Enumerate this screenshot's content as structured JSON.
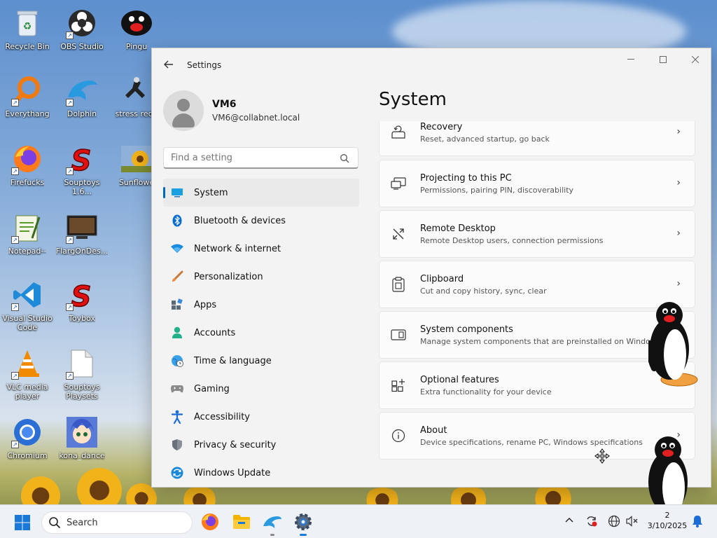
{
  "desktop": {
    "icons": [
      {
        "label": "Recycle Bin",
        "icon": "recycle-bin-icon"
      },
      {
        "label": "OBS Studio",
        "icon": "obs-icon"
      },
      {
        "label": "Pingu",
        "icon": "pingu-icon"
      },
      {
        "label": "Everythang",
        "icon": "everything-search-icon"
      },
      {
        "label": "Dolphin",
        "icon": "dolphin-icon"
      },
      {
        "label": "stress redu",
        "icon": "stress-reduction-icon"
      },
      {
        "label": "Firefucks",
        "icon": "firefox-icon"
      },
      {
        "label": "Souptoys 1.6...",
        "icon": "souptoys-icon"
      },
      {
        "label": "Sunflowe",
        "icon": "sunflower-icon"
      },
      {
        "label": "Notepad--",
        "icon": "notepad-icon"
      },
      {
        "label": "FlargOnDes...",
        "icon": "flarg-icon"
      },
      {
        "label": "Visual Studio Code",
        "icon": "vscode-icon"
      },
      {
        "label": "Toybox",
        "icon": "toybox-icon"
      },
      {
        "label": "VLC media player",
        "icon": "vlc-icon"
      },
      {
        "label": "Souptoys Playsets",
        "icon": "file-icon"
      },
      {
        "label": "Chromium",
        "icon": "chromium-icon"
      },
      {
        "label": "kona_dance",
        "icon": "kona-dance-icon"
      }
    ]
  },
  "window": {
    "title": "Settings",
    "controls": {
      "minimize": "—",
      "maximize": "☐",
      "close": "✕"
    },
    "profile": {
      "name": "VM6",
      "email": "VM6@collabnet.local"
    },
    "search": {
      "placeholder": "Find a setting"
    },
    "nav": [
      {
        "label": "System",
        "icon": "system-icon",
        "selected": true
      },
      {
        "label": "Bluetooth & devices",
        "icon": "bluetooth-icon"
      },
      {
        "label": "Network & internet",
        "icon": "wifi-icon"
      },
      {
        "label": "Personalization",
        "icon": "brush-icon"
      },
      {
        "label": "Apps",
        "icon": "apps-icon"
      },
      {
        "label": "Accounts",
        "icon": "accounts-icon"
      },
      {
        "label": "Time & language",
        "icon": "globe-clock-icon"
      },
      {
        "label": "Gaming",
        "icon": "gamepad-icon"
      },
      {
        "label": "Accessibility",
        "icon": "accessibility-icon"
      },
      {
        "label": "Privacy & security",
        "icon": "shield-icon"
      },
      {
        "label": "Windows Update",
        "icon": "update-icon"
      }
    ],
    "heading": "System",
    "cards": [
      {
        "title": "Recovery",
        "subtitle": "Reset, advanced startup, go back",
        "icon": "recovery-icon"
      },
      {
        "title": "Projecting to this PC",
        "subtitle": "Permissions, pairing PIN, discoverability",
        "icon": "projecting-icon"
      },
      {
        "title": "Remote Desktop",
        "subtitle": "Remote Desktop users, connection permissions",
        "icon": "remote-desktop-icon"
      },
      {
        "title": "Clipboard",
        "subtitle": "Cut and copy history, sync, clear",
        "icon": "clipboard-icon"
      },
      {
        "title": "System components",
        "subtitle": "Manage system components that are preinstalled on Windows",
        "icon": "system-components-icon"
      },
      {
        "title": "Optional features",
        "subtitle": "Extra functionality for your device",
        "icon": "optional-features-icon"
      },
      {
        "title": "About",
        "subtitle": "Device specifications, rename PC, Windows specifications",
        "icon": "info-icon"
      }
    ],
    "chevron": "›"
  },
  "taskbar": {
    "search_label": "Search",
    "clock": {
      "time": "2",
      "date": "3/10/2025"
    }
  },
  "colors": {
    "accent": "#0067c0",
    "window_bg": "#f3f3f3",
    "card_bg": "#fbfbfb",
    "taskbar_bg": "#eef1f6"
  }
}
